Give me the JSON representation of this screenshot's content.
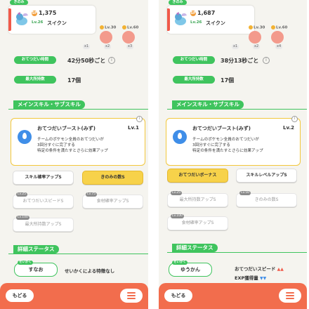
{
  "left": {
    "header_tag": "きのみ",
    "sp_badge": "SP",
    "sp_value": "1,375",
    "level": "Lv.26",
    "name": "スイクン",
    "berry1": {
      "lv": "Lv.30",
      "count": "x2"
    },
    "berry2": {
      "lv": "Lv.60",
      "count": "x3"
    },
    "extra_count": "x1",
    "helper_time_label": "おてつだい時間",
    "helper_time_value": "42分50秒ごと",
    "max_items_label": "最大所持数",
    "max_items_value": "17個",
    "section_skill": "メインスキル・サブスキル",
    "main_skill": {
      "title": "おてつだいブースト(みず)",
      "lv": "Lv.1",
      "desc": [
        "チームのポケモン全員のおてつだいが",
        "3回分すぐに完了する",
        "特定の条件を満たすとさらに効果アップ"
      ]
    },
    "subskills": [
      {
        "label": "スキル確率アップS",
        "style": "white",
        "lv": ""
      },
      {
        "label": "きのみの数S",
        "style": "yellow",
        "lv": ""
      },
      {
        "label": "おてつだいスピードS",
        "style": "gray",
        "lv": "Lv.25"
      },
      {
        "label": "食材確率アップS",
        "style": "gray",
        "lv": "Lv.75"
      },
      {
        "label": "最大所持数アップS",
        "style": "gray",
        "lv": "Lv.100"
      }
    ],
    "section_status": "詳細ステータス",
    "nature_label": "せいかく",
    "nature": "すなお",
    "nature_desc": "せいかくによる特徴なし",
    "back": "もどる"
  },
  "right": {
    "header_tag": "きのみ",
    "sp_badge": "SP",
    "sp_value": "1,687",
    "level": "Lv.26",
    "name": "スイクン",
    "berry1": {
      "lv": "Lv.30",
      "count": "x2"
    },
    "berry2": {
      "lv": "Lv.60",
      "count": "x4"
    },
    "extra_count": "x1",
    "helper_time_label": "おてつだい時間",
    "helper_time_value": "38分13秒ごと",
    "max_items_label": "最大所持数",
    "max_items_value": "17個",
    "section_skill": "メインスキル・サブスキル",
    "main_skill": {
      "title": "おてつだいブースト(みず)",
      "lv": "Lv.2",
      "desc": [
        "チームのポケモン全員のおてつだいが",
        "3回分すぐに完了する",
        "特定の条件を満たすとさらに効果アップ"
      ]
    },
    "subskills": [
      {
        "label": "おてつだいボーナス",
        "style": "yellow",
        "lv": ""
      },
      {
        "label": "スキルレベルアップS",
        "style": "white",
        "lv": ""
      },
      {
        "label": "最大所持数アップS",
        "style": "gray",
        "lv": "Lv.25"
      },
      {
        "label": "きのみの数S",
        "style": "gray",
        "lv": "Lv.50"
      },
      {
        "label": "食材確率アップS",
        "style": "gray",
        "lv": "Lv.100"
      }
    ],
    "section_status": "詳細ステータス",
    "nature_label": "せいかく",
    "nature": "ゆうかん",
    "nature_up": "おてつだいスピード",
    "nature_down": "EXP獲得量",
    "back": "もどる"
  },
  "colors": {
    "accent_green": "#3fc45e",
    "bottom_bar": "#f26d4d",
    "yellow": "#f7d24a",
    "berry": "#f39a8c"
  }
}
